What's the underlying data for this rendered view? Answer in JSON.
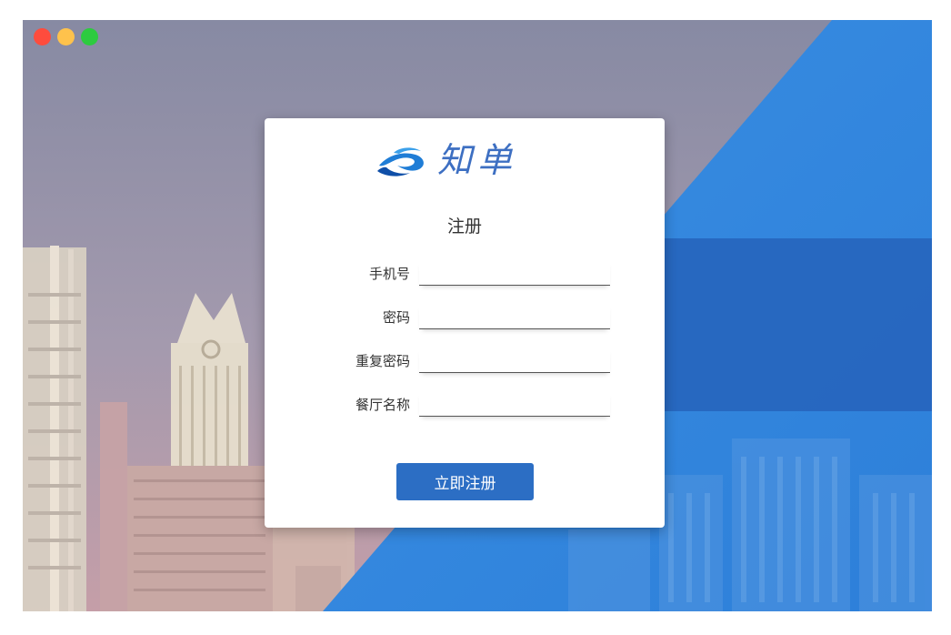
{
  "window": {
    "controls": [
      "close",
      "minimize",
      "maximize"
    ]
  },
  "brand": {
    "name": "知单",
    "logo_icon": "wave-logo-icon"
  },
  "form": {
    "title": "注册",
    "fields": [
      {
        "label": "手机号",
        "value": "",
        "placeholder": ""
      },
      {
        "label": "密码",
        "value": "",
        "placeholder": ""
      },
      {
        "label": "重复密码",
        "value": "",
        "placeholder": ""
      },
      {
        "label": "餐厅名称",
        "value": "",
        "placeholder": ""
      }
    ],
    "submit_label": "立即注册"
  },
  "colors": {
    "accent": "#2c6ec4",
    "background_left": "#8b8ca2",
    "background_right": "#2f86e0"
  }
}
